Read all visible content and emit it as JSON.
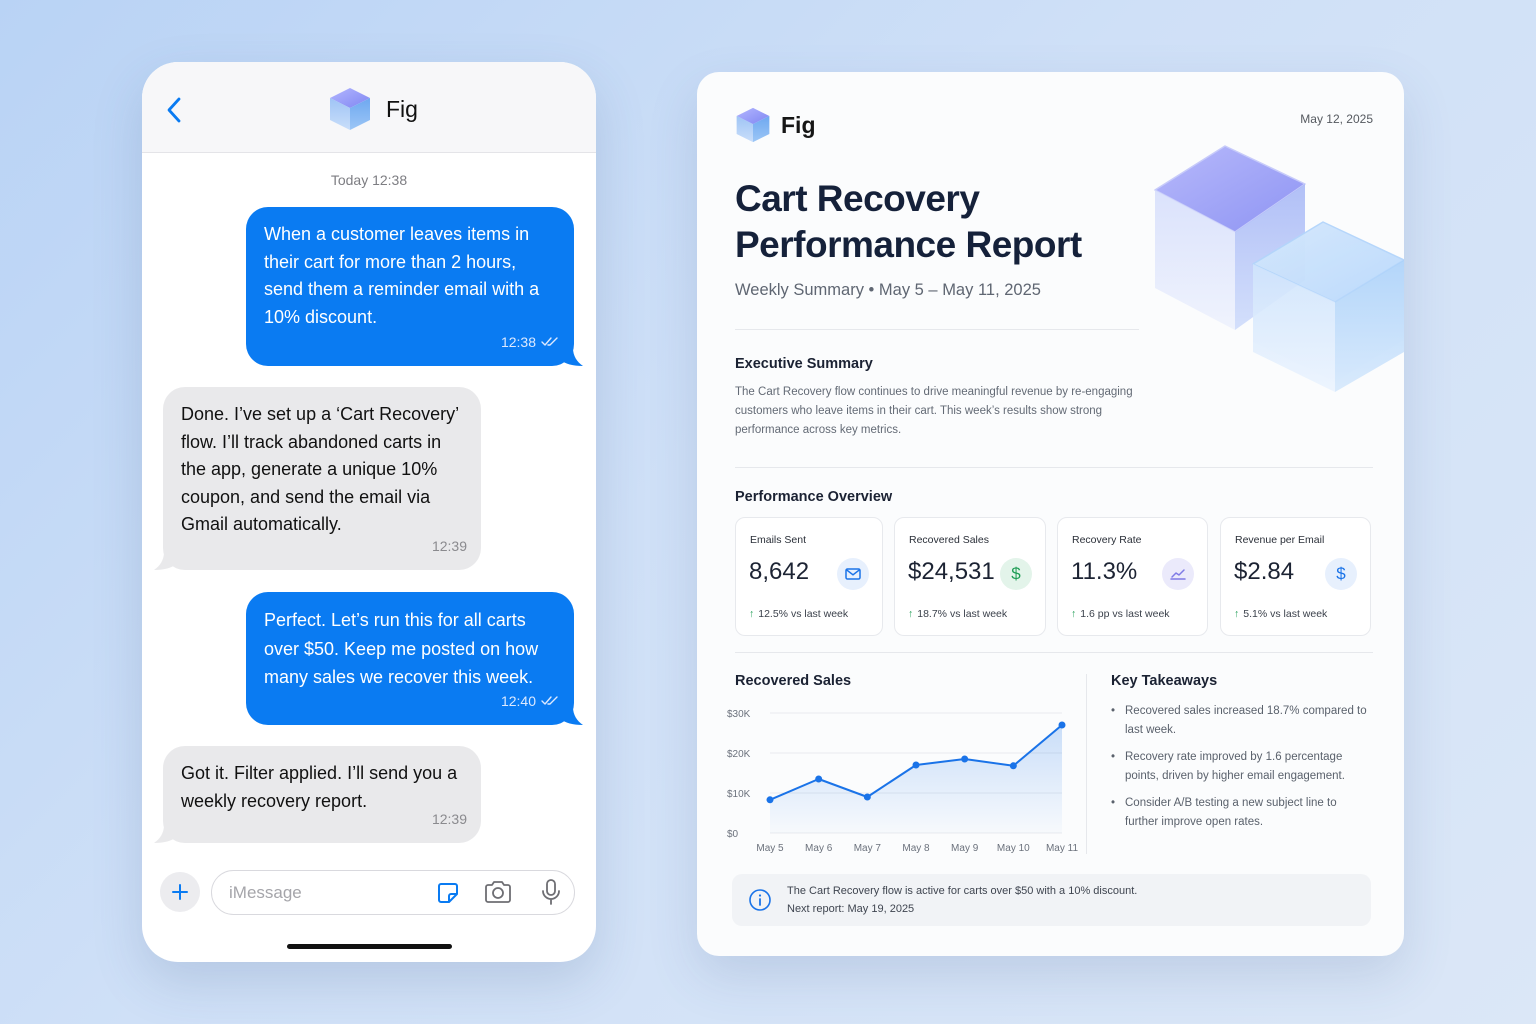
{
  "colors": {
    "imessage_blue": "#0a7bf2",
    "received_gray": "#e9e9eb",
    "accent": "#1a73e8",
    "positive": "#1f9d55"
  },
  "phone": {
    "contact_name": "Fig",
    "contact_icon": "cube-logo-icon",
    "day_timestamp": "Today 12:38",
    "messages": [
      {
        "direction": "out",
        "text": "When a customer leaves items in their cart for more than 2 hours, send them a reminder email with a 10% discount.",
        "time": "12:38",
        "status": "read"
      },
      {
        "direction": "in",
        "text": "Done. I’ve set up a ‘Cart Recovery’ flow. I’ll track abandoned carts in the app, generate a unique 10% coupon, and send the email via Gmail automatically.",
        "time": "12:39"
      },
      {
        "direction": "out",
        "text": "Perfect. Let’s run this for all carts over $50. Keep me posted on how many sales we recover this week.",
        "time": "12:40",
        "status": "read"
      },
      {
        "direction": "in",
        "text": "Got it. Filter applied. I’ll send you a weekly recovery report.",
        "time": "12:39"
      }
    ],
    "composer": {
      "placeholder": "iMessage"
    }
  },
  "report": {
    "brand": "Fig",
    "date": "May 12, 2025",
    "title": "Cart Recovery Performance Report",
    "subtitle": "Weekly Summary • May 5 – May 11, 2025",
    "executive_summary": {
      "heading": "Executive Summary",
      "text": "The Cart Recovery flow continues to drive meaningful revenue by re-engaging customers who leave items in their cart. This week’s results show strong performance across key metrics."
    },
    "performance_overview": {
      "heading": "Performance Overview",
      "kpis": [
        {
          "label": "Emails Sent",
          "value": "8,642",
          "delta": "12.5% vs last week",
          "icon": "mail-icon"
        },
        {
          "label": "Recovered Sales",
          "value": "$24,531",
          "delta": "18.7% vs last week",
          "icon": "dollar-icon"
        },
        {
          "label": "Recovery Rate",
          "value": "11.3%",
          "delta": "1.6 pp vs last week",
          "icon": "trend-icon"
        },
        {
          "label": "Revenue per Email",
          "value": "$2.84",
          "delta": "5.1% vs last week",
          "icon": "dollar-icon"
        }
      ]
    },
    "recovered_sales_heading": "Recovered Sales",
    "key_takeaways": {
      "heading": "Key Takeaways",
      "items": [
        "Recovered sales increased 18.7% compared to last week.",
        "Recovery rate improved by 1.6 percentage points, driven by higher email engagement.",
        "Consider A/B testing a new subject line to further improve open rates."
      ]
    },
    "footer": {
      "line1": "The Cart Recovery flow is active for carts over $50 with a 10% discount.",
      "line2": "Next report: May 19, 2025"
    }
  },
  "chart_data": {
    "type": "area",
    "title": "Recovered Sales",
    "x": [
      "May 5",
      "May 6",
      "May 7",
      "May 8",
      "May 9",
      "May 10",
      "May 11"
    ],
    "series": [
      {
        "values": [
          8300,
          13500,
          9000,
          17000,
          18500,
          16800,
          27000
        ]
      }
    ],
    "ylim": [
      0,
      30000
    ],
    "yticks": [
      "$0",
      "$10K",
      "$20K",
      "$30K"
    ],
    "grid": true
  }
}
